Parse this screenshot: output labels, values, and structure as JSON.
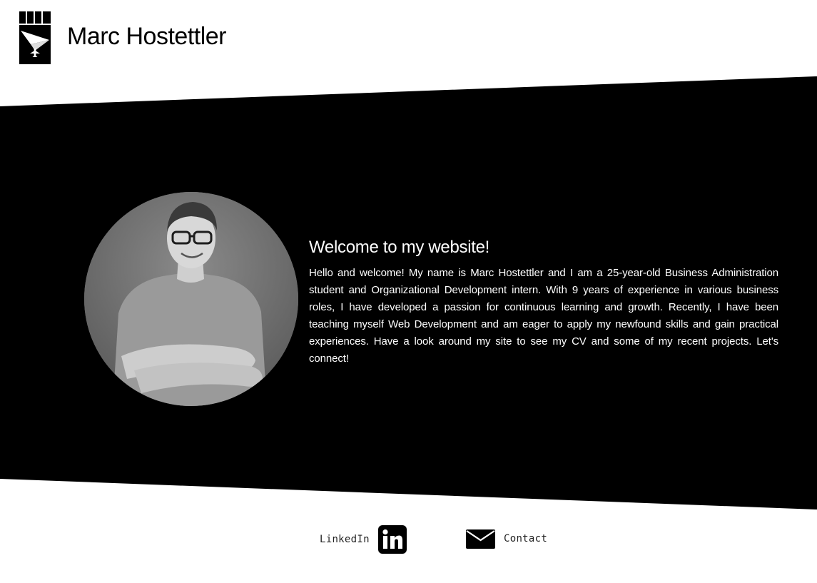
{
  "header": {
    "site_title": "Marc Hostettler",
    "logo_icon": "fist-paper-plane-logo-icon"
  },
  "colors": {
    "band": "#000000",
    "background": "#ffffff",
    "text_on_band": "#ffffff"
  },
  "intro": {
    "profile_photo": "profile-photo-portrait",
    "heading": "Welcome to my website!",
    "text": "Hello and welcome! My name is Marc Hostettler and I am a 25-year-old Business Administration student and Organizational Development intern. With 9 years of experience in various business roles, I have developed a passion for continuous learning and growth. Recently, I have been teaching myself Web Development and am eager to apply my newfound skills and gain practical experiences. Have a look around my site to see my CV and some of my recent projects. Let's connect!"
  },
  "footer": {
    "linkedin_label": "LinkedIn",
    "linkedin_icon": "linkedin-icon",
    "contact_label": "Contact",
    "contact_icon": "envelope-icon"
  }
}
